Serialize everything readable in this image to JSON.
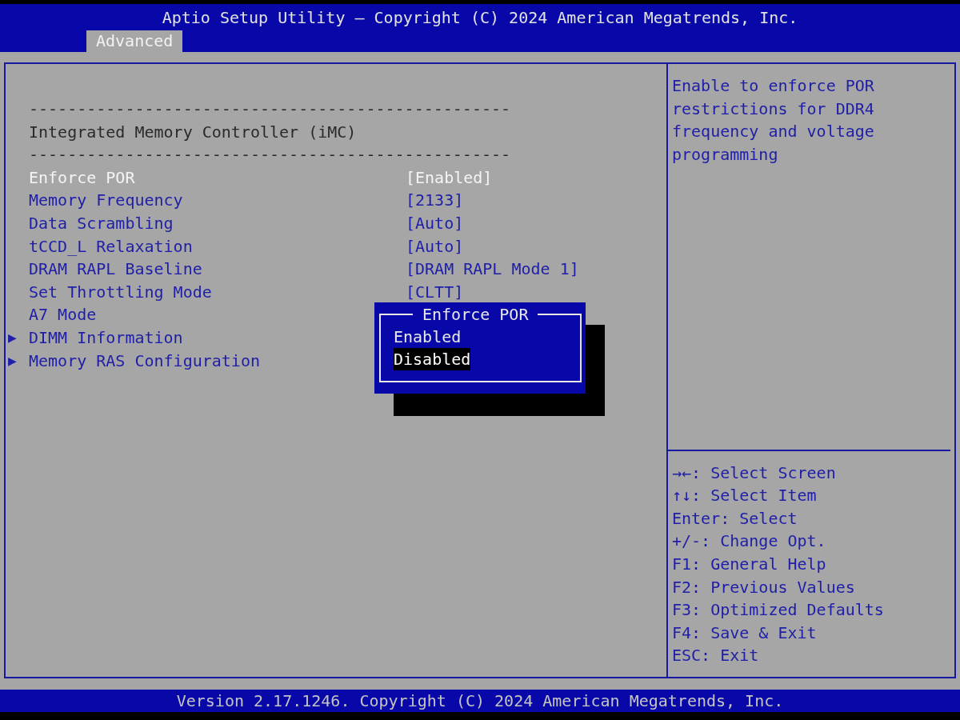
{
  "header": {
    "title": "Aptio Setup Utility – Copyright (C) 2024 American Megatrends, Inc.",
    "tabs": [
      {
        "label": "Advanced",
        "selected": true
      }
    ]
  },
  "settings": {
    "items": [
      {
        "kind": "separator",
        "text": "--------------------------------------------------"
      },
      {
        "kind": "heading",
        "text": "Integrated Memory Controller (iMC)"
      },
      {
        "kind": "separator",
        "text": "--------------------------------------------------"
      },
      {
        "kind": "option",
        "label": "Enforce POR",
        "value": "[Enabled]",
        "selected": true
      },
      {
        "kind": "option",
        "label": "Memory Frequency",
        "value": "[2133]",
        "selected": false
      },
      {
        "kind": "option",
        "label": "Data Scrambling",
        "value": "[Auto]",
        "selected": false
      },
      {
        "kind": "option",
        "label": "tCCD_L Relaxation",
        "value": "[Auto]",
        "selected": false
      },
      {
        "kind": "option",
        "label": "DRAM RAPL Baseline",
        "value": "[DRAM RAPL Mode 1]",
        "selected": false
      },
      {
        "kind": "option",
        "label": "Set Throttling Mode",
        "value": "[CLTT]",
        "selected": false
      },
      {
        "kind": "option",
        "label": "A7 Mode",
        "selected": false
      },
      {
        "kind": "submenu",
        "marker": "▶",
        "label": "DIMM Information",
        "selected": false
      },
      {
        "kind": "submenu",
        "marker": "▶",
        "label": "Memory RAS Configuration",
        "selected": false
      }
    ]
  },
  "popup": {
    "title": "Enforce POR",
    "options": [
      {
        "label": "Enabled",
        "selected": false
      },
      {
        "label": "Disabled",
        "selected": true
      }
    ]
  },
  "help_text": "Enable to enforce POR restrictions for DDR4 frequency and voltage programming",
  "key_help": [
    "→←: Select Screen",
    "↑↓: Select Item",
    "Enter: Select",
    "+/-: Change Opt.",
    "F1: General Help",
    "F2: Previous Values",
    "F3: Optimized Defaults",
    "F4: Save & Exit",
    "ESC: Exit"
  ],
  "footer": "Version 2.17.1246. Copyright (C) 2024 American Megatrends, Inc."
}
